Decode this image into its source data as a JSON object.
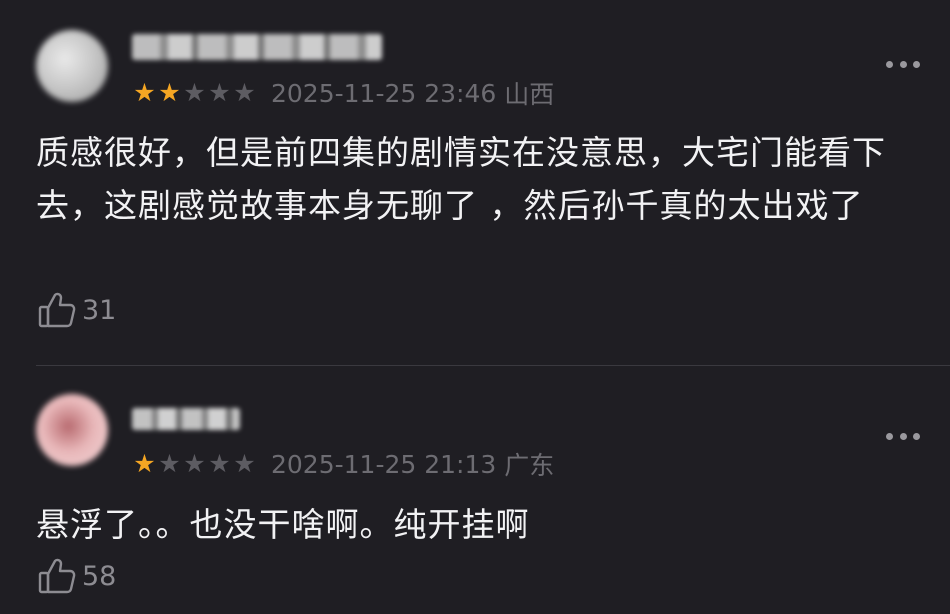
{
  "comments": [
    {
      "rating": 2,
      "max_rating": 5,
      "timestamp": "2025-11-25 23:46",
      "location": "山西",
      "text": "质感很好，但是前四集的剧情实在没意思，大宅门能看下去，这剧感觉故事本身无聊了 ，然后孙千真的太出戏了",
      "likes": "31",
      "like_icon": "thumbs-up-icon",
      "more_icon": "more-options-icon"
    },
    {
      "rating": 1,
      "max_rating": 5,
      "timestamp": "2025-11-25 21:13",
      "location": "广东",
      "text": "悬浮了。。也没干啥啊。纯开挂啊",
      "likes": "58",
      "like_icon": "thumbs-up-icon",
      "more_icon": "more-options-icon"
    }
  ],
  "colors": {
    "background": "#1f1e23",
    "star_filled": "#f5a623",
    "star_empty": "#5d5c62",
    "meta_text": "#6d6c72",
    "body_text": "#f2f2f4"
  }
}
